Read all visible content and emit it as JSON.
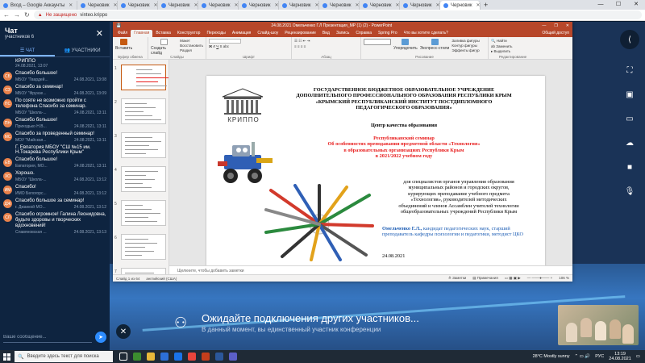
{
  "browser": {
    "tabs": [
      {
        "label": "Вход – Google Аккаунты",
        "active": false
      },
      {
        "label": "Черновик",
        "active": false
      },
      {
        "label": "Черновик",
        "active": false
      },
      {
        "label": "Черновик",
        "active": false
      },
      {
        "label": "Черновик",
        "active": false
      },
      {
        "label": "Черновик",
        "active": false
      },
      {
        "label": "Черновик",
        "active": false
      },
      {
        "label": "Черновик",
        "active": false
      },
      {
        "label": "Черновик",
        "active": false
      },
      {
        "label": "Черновик",
        "active": false
      },
      {
        "label": "Черновик",
        "active": true
      }
    ],
    "security": "Не защищено",
    "url": "vinteo.krippo"
  },
  "chat": {
    "title": "Чат",
    "subtitle": "участников 6",
    "tab_chat": "ЧАТ",
    "tab_participants": "УЧАСТНИКИ",
    "input_placeholder": "Ваше сообщение...",
    "messages": [
      {
        "type": "plain",
        "text": "КРИППО",
        "meta": "24.08.2021, 13:07"
      },
      {
        "type": "msg",
        "avatar": "СБ",
        "color": "#e8814a",
        "text": "Спасибо большое!",
        "sender": "МБОУ \"Гвардей...",
        "time": "24.08.2021, 13:08"
      },
      {
        "type": "msg",
        "avatar": "СЗ",
        "color": "#e8814a",
        "text": "Спасибо за семинар!",
        "sender": "МБОУ \"Фрунзе...",
        "time": "24.08.2021, 13:09"
      },
      {
        "type": "msg",
        "avatar": "ПС",
        "color": "#e8814a",
        "text": "По сояте не возможно пройти с телефона Спасибо за семинар.",
        "sender": "МБОУ \"Школа-...",
        "time": "24.08.2021, 13:11"
      },
      {
        "type": "msg",
        "avatar": "ПН",
        "color": "#e8814a",
        "text": "Спасибо большое!",
        "sender": "Приходько Н.В...",
        "time": "24.08.2021, 13:11"
      },
      {
        "type": "msg",
        "avatar": "МС",
        "color": "#e8814a",
        "text": "Спасибо за проведенный семинар!",
        "sender": "МОУ \"Майская...",
        "time": "24.08.2021, 13:11"
      },
      {
        "type": "plain",
        "text": "Г. Евпатория МБОУ \"СШ №15 им. Н.Токарева Республики Крым\"",
        "meta": ""
      },
      {
        "type": "msg",
        "avatar": "ЕВ",
        "color": "#e8814a",
        "text": "Спасибо большое!",
        "sender": "Евпатория, МО...",
        "time": "24.08.2021, 13:11"
      },
      {
        "type": "msg",
        "avatar": "ХО",
        "color": "#e8814a",
        "text": "Хорошо.",
        "sender": "МБОУ \"Школа-...",
        "time": "24.08.2021, 13:12"
      },
      {
        "type": "msg",
        "avatar": "ИМ",
        "color": "#e8814a",
        "text": "Спасибо!",
        "sender": "ИМО Белогорс...",
        "time": "24.08.2021, 13:12"
      },
      {
        "type": "msg",
        "avatar": "ДЖ",
        "color": "#e8814a",
        "text": "Спасибо большое за семинар!",
        "sender": "г. Джанкой МО...",
        "time": "24.08.2021, 13:12"
      },
      {
        "type": "msg",
        "avatar": "СЛ",
        "color": "#e8814a",
        "text": "Спасибо огромное! Галина Леонидовна, будьте здоровы и творческих вдохновений!",
        "sender": "Славяновская ...",
        "time": "24.08.2021, 13:13"
      }
    ]
  },
  "powerpoint": {
    "title": "24.08.2021 Омельченко Г.Л Презентация_МР (1) (2)  -  PowerPoint",
    "tabs": [
      "Файл",
      "Главная",
      "Вставка",
      "Конструктор",
      "Переходы",
      "Анимация",
      "Слайд-шоу",
      "Рецензирование",
      "Вид",
      "Запись",
      "Справка",
      "Spring Pro",
      "Что вы хотите сделать?"
    ],
    "share": "Общий доступ",
    "ribbon": {
      "clipboard": "Буфер обмена",
      "paste": "Вставить",
      "slides": "Слайды",
      "create": "Создать слайд",
      "layout": "Макет",
      "reset": "Восстановить",
      "section": "Раздел",
      "font": "Шрифт",
      "paragraph": "Абзац",
      "drawing": "Рисование",
      "arrange": "Упорядочить",
      "quick_styles": "Экспресс-стили",
      "fill": "Заливка фигуры",
      "outline": "Контур фигуры",
      "effects": "Эффекты фигур",
      "editing": "Редактирование",
      "find": "Найти",
      "replace": "Заменить",
      "select": "Выделить"
    },
    "slide_numbers": [
      "1",
      "2",
      "3",
      "4",
      "5",
      "6",
      "7"
    ],
    "notes_placeholder": "Щелкните, чтобы добавить заметки",
    "status": {
      "slide": "Слайд 1 из 64",
      "lang": "английский (США)",
      "notes": "Заметки",
      "comments": "Примечания",
      "zoom": "106 %"
    },
    "slide": {
      "logo_text": "КРИППО",
      "org": [
        "ГОСУДАРСТВЕННОЕ БЮДЖЕТНОЕ ОБРАЗОВАТЕЛЬНОЕ УЧРЕЖДЕНИЕ",
        "ДОПОЛНИТЕЛЬНОГО ПРОФЕССИОНАЛЬНОГО ОБРАЗОВАНИЯ РЕСПУБЛИКИ КРЫМ",
        "«КРЫМСКИЙ РЕСПУБЛИКАНСКИЙ ИНСТИТУТ ПОСТДИПЛОМНОГО",
        "ПЕДАГОГИЧЕСКОГО ОБРАЗОВАНИЯ»"
      ],
      "center": "Центр качества образования",
      "seminar": [
        "Республиканский семинар",
        "Об особенностях преподавания предметной области «Технология»",
        "в образовательных организациях Республики Крым",
        "в 2021/2022 учебном году"
      ],
      "audience": [
        "для специалистов органов управления образования",
        "муниципальных районов и городских округов,",
        "курирующих преподавание учебного предмета",
        "«Технология», руководителей методических",
        "объединений и членов Ассамблеи учителей технологии",
        "общеобразовательных учреждений Республики Крым"
      ],
      "speaker_name": "Омельченко Г.Л.,",
      "speaker_rest": " кандидат педагогических наук, старший преподаватель кафедры психологии и педагогики, методист ЦКО",
      "date": "24.08.2021"
    }
  },
  "conference": {
    "wait_title": "Ожидайте подключения других участников...",
    "wait_sub": "В данный момент, вы единственный участник конференции"
  },
  "taskbar": {
    "search": "Введите здесь текст для поиска",
    "weather": "28°C  Mostly sunny",
    "lang": "РУС",
    "time": "13:19",
    "date": "24.08.2021"
  }
}
